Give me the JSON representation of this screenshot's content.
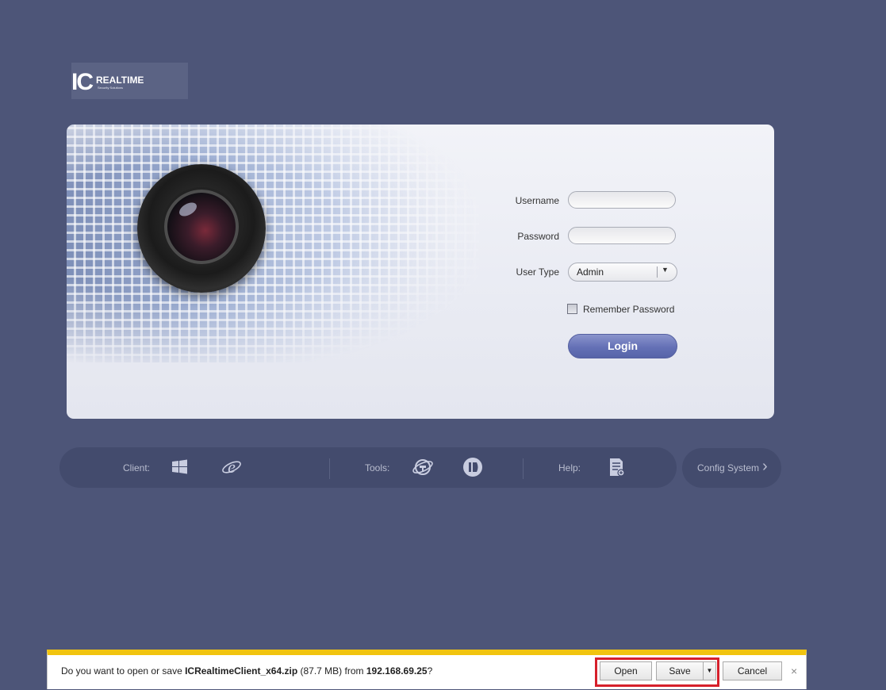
{
  "logo": {
    "mark": "IC",
    "name": "REALTIME",
    "tagline": "Security Solutions"
  },
  "login": {
    "username_label": "Username",
    "username_value": "",
    "password_label": "Password",
    "password_value": "",
    "user_type_label": "User Type",
    "user_type_value": "Admin",
    "remember_label": "Remember Password",
    "remember_checked": false,
    "login_button": "Login"
  },
  "toolbar": {
    "client_label": "Client:",
    "tools_label": "Tools:",
    "help_label": "Help:",
    "icons": {
      "client": [
        "windows-icon",
        "internet-explorer-icon"
      ],
      "tools": [
        "ie-plugin-icon",
        "player-icon"
      ],
      "help": [
        "document-icon"
      ]
    }
  },
  "config": {
    "label": "Config System"
  },
  "download": {
    "prefix": "Do you want to open or save ",
    "filename": "ICRealtimeClient_x64.zip",
    "size": " (87.7 MB) from ",
    "host": "192.168.69.25",
    "suffix": "?",
    "open": "Open",
    "save": "Save",
    "cancel": "Cancel",
    "close": "×"
  },
  "colors": {
    "background": "#4d5578",
    "accent": "#6470b6",
    "download_bar_border": "#f1c40f",
    "highlight": "#d6202b"
  }
}
